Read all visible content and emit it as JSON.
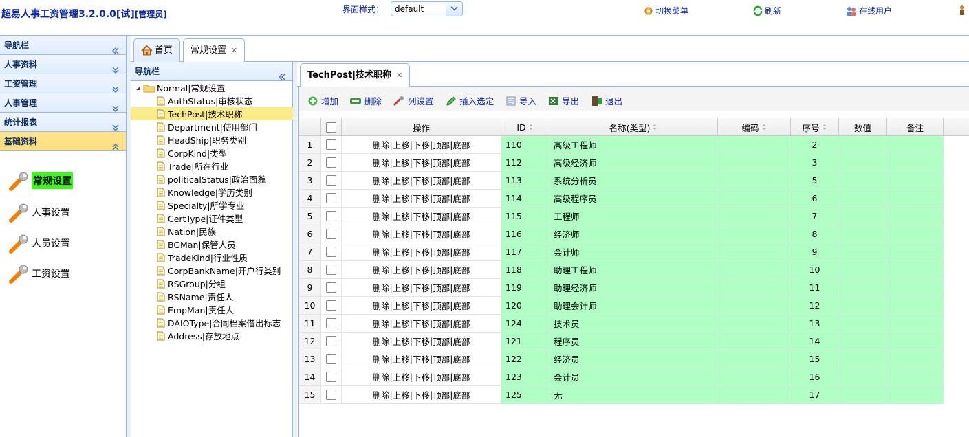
{
  "header": {
    "title": "超易人事工资管理3.2.0.0[试]",
    "role": "[管理员]",
    "style_label": "界面样式：",
    "style_value": "default",
    "switch_menu": "切换菜单",
    "refresh": "刷新",
    "online_users": "在线用户"
  },
  "left_nav": {
    "title": "导航栏",
    "sections": [
      "人事资料",
      "工资管理",
      "人事管理",
      "统计报表",
      "基础资料"
    ],
    "links": [
      "常规设置",
      "人事设置",
      "人员设置",
      "工资设置"
    ]
  },
  "main_tabs": {
    "home": "首页",
    "general": "常规设置"
  },
  "sub_nav": {
    "title": "导航栏",
    "root": "Normal|常规设置",
    "nodes": [
      "AuthStatus|审核状态",
      "TechPost|技术职称",
      "Department|使用部门",
      "HeadShip|职务类别",
      "CorpKind|类型",
      "Trade|所在行业",
      "politicalStatus|政治面貌",
      "Knowledge|学历类别",
      "Specialty|所学专业",
      "CertType|证件类型",
      "Nation|民族",
      "BGMan|保管人员",
      "TradeKind|行业性质",
      "CorpBankName|开户行类别",
      "RSGroup|分组",
      "RSName|责任人",
      "EmpMan|责任人",
      "DAIOType|合同档案借出标志",
      "Address|存放地点"
    ]
  },
  "content_tab": "TechPost|技术职称",
  "toolbar": {
    "add": "增加",
    "delete": "删除",
    "columns": "列设置",
    "insert": "插入选定",
    "import": "导入",
    "export": "导出",
    "exit": "退出"
  },
  "grid": {
    "headers": {
      "ops": "操作",
      "id": "ID",
      "name": "名称(类型)",
      "code": "编码",
      "seq": "序号",
      "value": "数值",
      "note": "备注"
    },
    "ops": {
      "del": "删除",
      "up": "上移",
      "down": "下移",
      "top": "顶部",
      "bottom": "底部",
      "sep": "|"
    },
    "rows": [
      {
        "n": "1",
        "id": "110",
        "name": "高级工程师",
        "seq": "2"
      },
      {
        "n": "2",
        "id": "112",
        "name": "高级经济师",
        "seq": "3"
      },
      {
        "n": "3",
        "id": "113",
        "name": "系统分析员",
        "seq": "5"
      },
      {
        "n": "4",
        "id": "114",
        "name": "高级程序员",
        "seq": "6"
      },
      {
        "n": "5",
        "id": "115",
        "name": "工程师",
        "seq": "7"
      },
      {
        "n": "6",
        "id": "116",
        "name": "经济师",
        "seq": "8"
      },
      {
        "n": "7",
        "id": "117",
        "name": "会计师",
        "seq": "9"
      },
      {
        "n": "8",
        "id": "118",
        "name": "助理工程师",
        "seq": "10"
      },
      {
        "n": "9",
        "id": "119",
        "name": "助理经济师",
        "seq": "11"
      },
      {
        "n": "10",
        "id": "120",
        "name": "助理会计师",
        "seq": "12"
      },
      {
        "n": "11",
        "id": "124",
        "name": "技术员",
        "seq": "13"
      },
      {
        "n": "12",
        "id": "121",
        "name": "程序员",
        "seq": "14"
      },
      {
        "n": "13",
        "id": "122",
        "name": "经济员",
        "seq": "15"
      },
      {
        "n": "14",
        "id": "123",
        "name": "会计员",
        "seq": "16"
      },
      {
        "n": "15",
        "id": "125",
        "name": "无",
        "seq": "17"
      }
    ]
  },
  "colors": {
    "accent": "#0d27a0",
    "row_green": "#b0ffc4",
    "selected_node": "#fbec88",
    "active_link": "#39ff14"
  }
}
